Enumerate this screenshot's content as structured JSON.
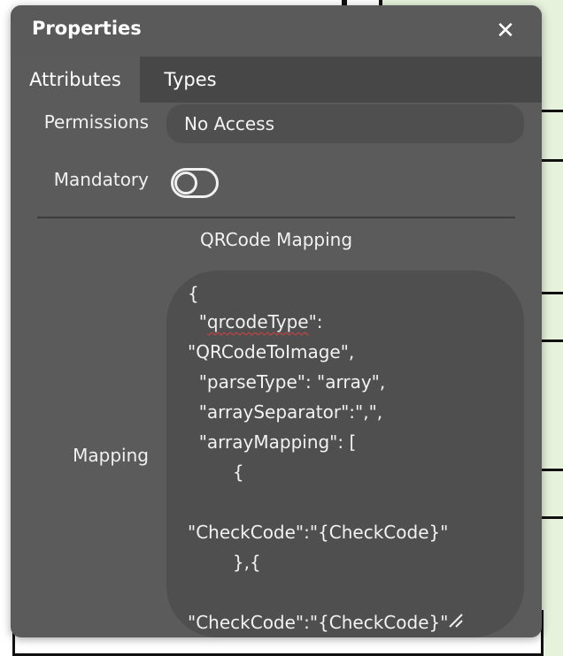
{
  "panel": {
    "title": "Properties",
    "close_icon": "close-icon",
    "close_glyph": "✕"
  },
  "tabs": [
    {
      "label": "Attributes",
      "active": true
    },
    {
      "label": "Types",
      "active": false
    }
  ],
  "permissions": {
    "label": "Permissions",
    "value": "No Access"
  },
  "mandatory": {
    "label": "Mandatory",
    "enabled": false
  },
  "section": {
    "title": "QRCode Mapping"
  },
  "mapping": {
    "label": "Mapping",
    "lines": [
      "{",
      "  \"",
      "qrcodeType",
      "\":",
      "\"QRCodeToImage\",",
      "  \"parseType\": \"array\",",
      "  \"arraySeparator\":\",\",",
      "  \"arrayMapping\": [",
      "        {",
      "\"CheckCode\":\"{CheckCode}\"",
      "        },{",
      "\"CheckCode\":\"{CheckCode}\""
    ]
  },
  "colors": {
    "panel_bg": "#5b5b5b",
    "tabbar_bg": "#474747",
    "field_bg": "#4f4f4f",
    "text": "#f2f2f2",
    "spell_error": "#d94040"
  }
}
